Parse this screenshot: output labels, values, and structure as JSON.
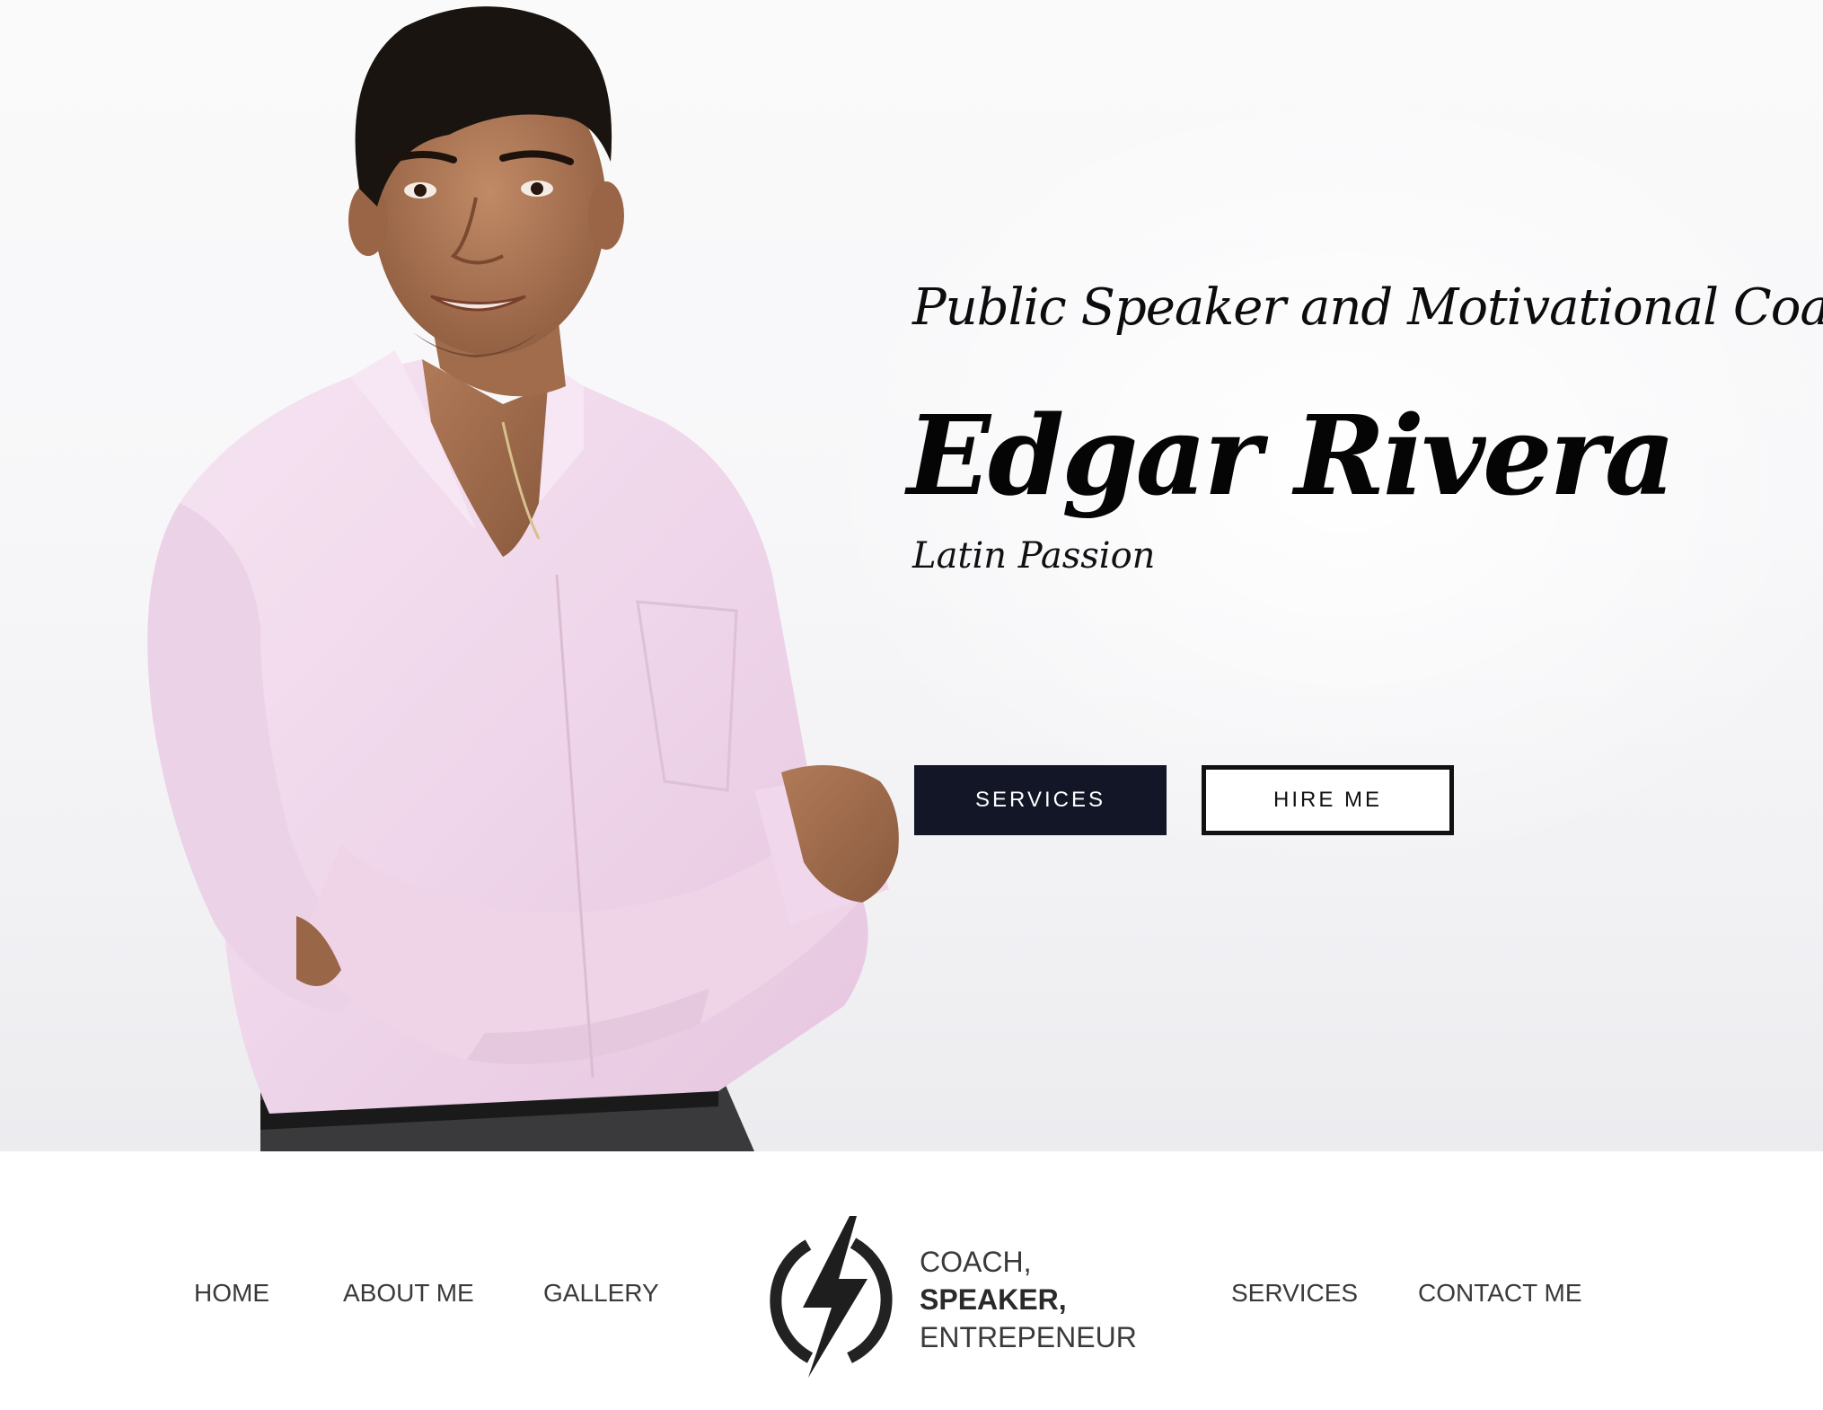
{
  "hero": {
    "subtitle": "Public Speaker and Motivational Coach",
    "name": "Edgar Rivera",
    "tagline": "Latin Passion",
    "buttons": {
      "services_label": "SERVICES",
      "hire_label": "HIRE ME"
    }
  },
  "nav": {
    "left_items": [
      "HOME",
      "ABOUT ME",
      "GALLERY"
    ],
    "right_items": [
      "SERVICES",
      "CONTACT ME"
    ],
    "logo": {
      "line1": "COACH,",
      "line2": "SPEAKER,",
      "line3": "ENTREPENEUR",
      "icon": "lightning-bolt-icon"
    }
  },
  "colors": {
    "primary_button": "#121626",
    "text_dark": "#0c0c0c",
    "nav_text": "#3a3a3a",
    "shirt": "#f0d9ec"
  }
}
